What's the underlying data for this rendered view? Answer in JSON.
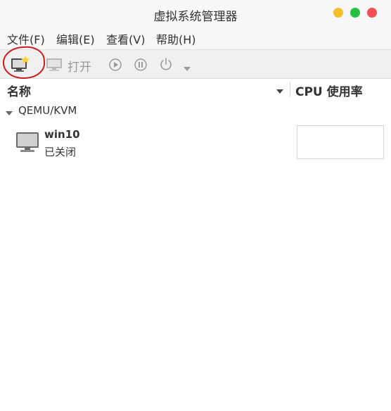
{
  "window": {
    "title": "虚拟系统管理器",
    "controls": [
      "minimize",
      "maximize",
      "close"
    ],
    "control_colors": {
      "minimize": "#f4bf2a",
      "maximize": "#26c13f",
      "close": "#f25056"
    }
  },
  "menu": [
    {
      "label": "文件(F)"
    },
    {
      "label": "编辑(E)"
    },
    {
      "label": "查看(V)"
    },
    {
      "label": "帮助(H)"
    }
  ],
  "toolbar": {
    "new_vm_icon": "new-vm-icon",
    "open_label": "打开",
    "open_icon": "monitor-icon",
    "run_icon": "play-icon",
    "pause_icon": "pause-icon",
    "shutdown_icon": "power-icon",
    "shutdown_menu_icon": "chevron-down-icon",
    "highlight_color": "#c81e1e"
  },
  "columns": {
    "name": "名称",
    "cpu": "CPU 使用率"
  },
  "connections": [
    {
      "label": "QEMU/KVM",
      "vms": [
        {
          "name": "win10",
          "status": "已关闭"
        }
      ]
    }
  ]
}
